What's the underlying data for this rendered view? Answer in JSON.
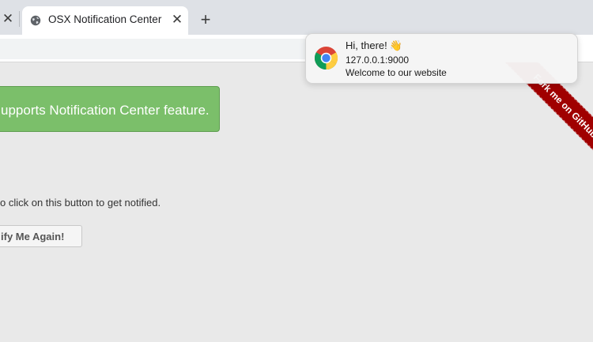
{
  "browser": {
    "tabs": [
      {
        "title": "OSX Notification Center",
        "active": true,
        "icon": "globe-icon"
      }
    ],
    "close_symbol": "✕",
    "new_tab_symbol": "+"
  },
  "page": {
    "alert_text": "upports Notification Center feature.",
    "hint_text": "o click on this button to get notified.",
    "notify_button_label": "ify Me Again!",
    "ribbon_text": "Fork me on GitHub"
  },
  "notification": {
    "title": "Hi, there!",
    "title_emoji": "👋",
    "host": "127.0.0.1:9000",
    "body": "Welcome to our website",
    "icon": "chrome-icon"
  },
  "colors": {
    "alert_bg": "#7bbf6a",
    "ribbon_bg": "#a00000",
    "tabbar_bg": "#dee1e6",
    "page_bg": "#e9e9e9"
  }
}
